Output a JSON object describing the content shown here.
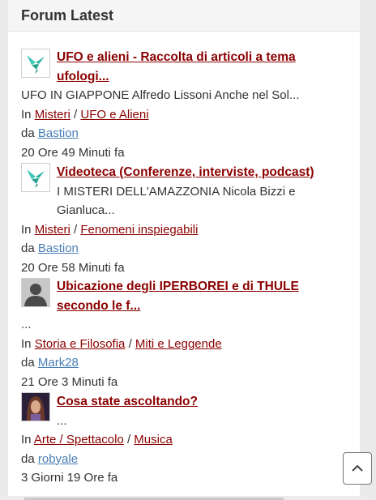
{
  "widget": {
    "title": "Forum Latest"
  },
  "labels": {
    "in": "In",
    "sep": "/",
    "by": "da"
  },
  "posts": [
    {
      "avatar": "hummingbird-avatar",
      "title": "UFO e alieni - Raccolta di articoli a tema ufologi...",
      "excerpt": "UFO IN GIAPPONE Alfredo Lissoni Anche nel Sol...",
      "category": "Misteri",
      "subcategory": "UFO e Alieni",
      "author": "Bastion",
      "time": "20 Ore 49 Minuti fa"
    },
    {
      "avatar": "hummingbird-avatar",
      "title": "Videoteca (Conferenze, interviste, podcast)",
      "excerpt": "I MISTERI DELL'AMAZZONIA Nicola Bizzi e Gianluca...",
      "category": "Misteri",
      "subcategory": "Fenomeni inspiegabili",
      "author": "Bastion",
      "time": "20 Ore 58 Minuti fa"
    },
    {
      "avatar": "default-user-avatar",
      "title": "Ubicazione degli IPERBOREI e di THULE secondo le f...",
      "excerpt": "...",
      "category": "Storia e Filosofia",
      "subcategory": "Miti e Leggende",
      "author": "Mark28",
      "time": "21 Ore 3 Minuti fa"
    },
    {
      "avatar": "photo-avatar",
      "title": "Cosa state ascoltando?",
      "excerpt": "...",
      "category": "Arte / Spettacolo",
      "subcategory": "Musica",
      "author": "robyale",
      "time": "3 Giorni 19 Ore fa"
    }
  ],
  "back_to_top": {
    "icon": "chevron-up-icon"
  },
  "colors": {
    "link": "#8b0000",
    "user_link": "#4a7fb5",
    "header_bg": "#f5f5f5"
  }
}
